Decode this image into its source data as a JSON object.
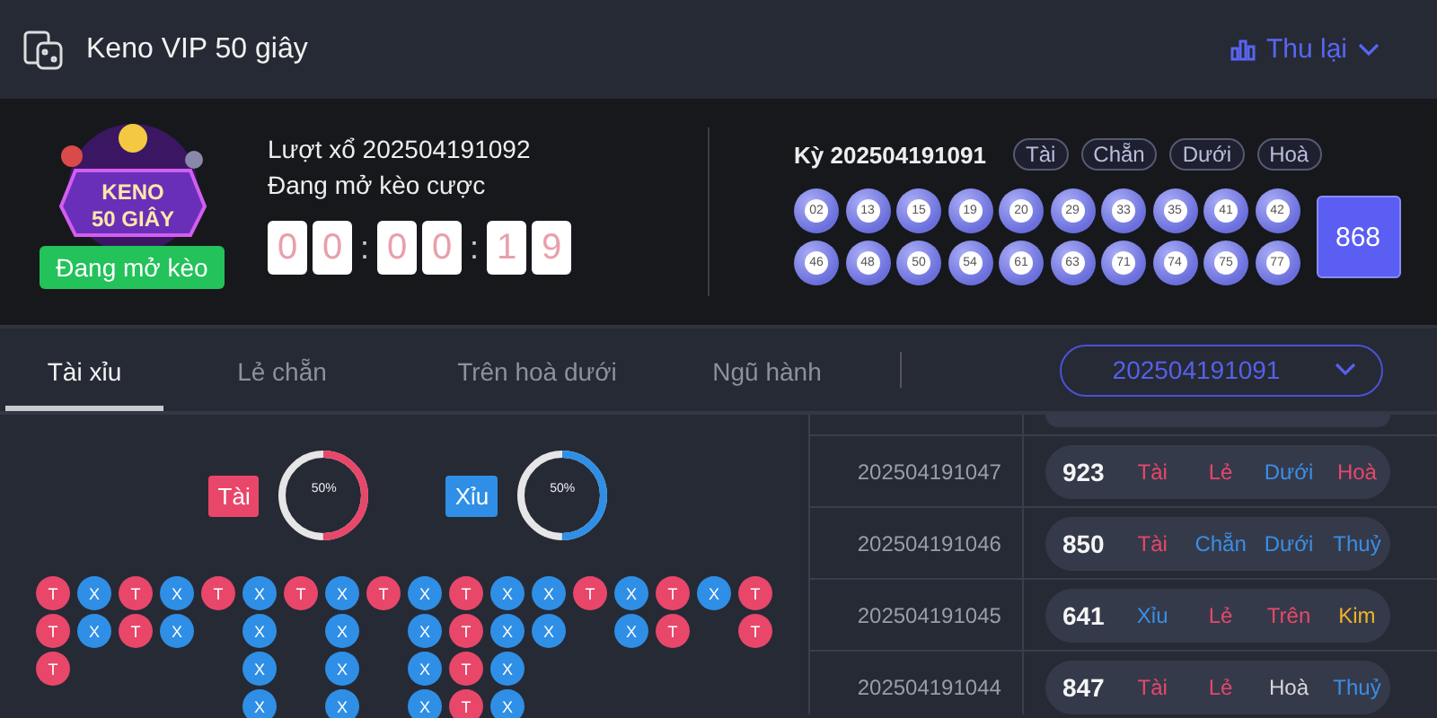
{
  "header": {
    "title": "Keno VIP 50 giây",
    "collapse_label": "Thu lại"
  },
  "current_draw": {
    "logo": {
      "line_1": "KENO",
      "line_2": "50 GIÂY"
    },
    "status_badge": "Đang mở kèo",
    "round_label": "Lượt xổ 202504191092",
    "status_text": "Đang mở kèo cược",
    "countdown": [
      {
        "kind": "digit",
        "text": "0"
      },
      {
        "kind": "digit",
        "text": "0"
      },
      {
        "kind": "separator",
        "text": ":"
      },
      {
        "kind": "digit",
        "text": "0"
      },
      {
        "kind": "digit",
        "text": "0"
      },
      {
        "kind": "separator",
        "text": ":"
      },
      {
        "kind": "digit",
        "text": "1"
      },
      {
        "kind": "digit",
        "text": "9"
      }
    ]
  },
  "last_draw": {
    "label": "Kỳ 202504191091",
    "tags": [
      "Tài",
      "Chẵn",
      "Dưới",
      "Hoà"
    ],
    "balls": [
      "02",
      "13",
      "15",
      "19",
      "20",
      "29",
      "33",
      "35",
      "41",
      "42",
      "46",
      "48",
      "50",
      "54",
      "61",
      "63",
      "71",
      "74",
      "75",
      "77"
    ],
    "total": "868"
  },
  "tabs": [
    {
      "label": "Tài xỉu",
      "selected": true
    },
    {
      "label": "Lẻ chẵn",
      "selected": false
    },
    {
      "label": "Trên hoà dưới",
      "selected": false
    },
    {
      "label": "Ngũ hành",
      "selected": false
    }
  ],
  "period_select": {
    "value": "202504191091"
  },
  "stats": [
    {
      "label": "Tài",
      "color": "#e8476a",
      "level": 0.5,
      "percent": "50%"
    },
    {
      "label": "Xỉu",
      "color": "#2f8fe6",
      "level": 0.5,
      "percent": "50%"
    }
  ],
  "bead_road": {
    "columns": [
      [
        {
          "label": "T",
          "color": "#e8476a"
        },
        {
          "label": "T",
          "color": "#e8476a"
        },
        {
          "label": "T",
          "color": "#e8476a"
        }
      ],
      [
        {
          "label": "X",
          "color": "#2f8fe6"
        },
        {
          "label": "X",
          "color": "#2f8fe6"
        }
      ],
      [
        {
          "label": "T",
          "color": "#e8476a"
        },
        {
          "label": "T",
          "color": "#e8476a"
        }
      ],
      [
        {
          "label": "X",
          "color": "#2f8fe6"
        },
        {
          "label": "X",
          "color": "#2f8fe6"
        }
      ],
      [
        {
          "label": "T",
          "color": "#e8476a"
        }
      ],
      [
        {
          "label": "X",
          "color": "#2f8fe6"
        },
        {
          "label": "X",
          "color": "#2f8fe6"
        },
        {
          "label": "X",
          "color": "#2f8fe6"
        },
        {
          "label": "X",
          "color": "#2f8fe6"
        }
      ],
      [
        {
          "label": "T",
          "color": "#e8476a"
        }
      ],
      [
        {
          "label": "X",
          "color": "#2f8fe6"
        },
        {
          "label": "X",
          "color": "#2f8fe6"
        },
        {
          "label": "X",
          "color": "#2f8fe6"
        },
        {
          "label": "X",
          "color": "#2f8fe6"
        }
      ],
      [
        {
          "label": "T",
          "color": "#e8476a"
        }
      ],
      [
        {
          "label": "X",
          "color": "#2f8fe6"
        },
        {
          "label": "X",
          "color": "#2f8fe6"
        },
        {
          "label": "X",
          "color": "#2f8fe6"
        },
        {
          "label": "X",
          "color": "#2f8fe6"
        }
      ],
      [
        {
          "label": "T",
          "color": "#e8476a"
        },
        {
          "label": "T",
          "color": "#e8476a"
        },
        {
          "label": "T",
          "color": "#e8476a"
        },
        {
          "label": "T",
          "color": "#e8476a"
        }
      ],
      [
        {
          "label": "X",
          "color": "#2f8fe6"
        },
        {
          "label": "X",
          "color": "#2f8fe6"
        },
        {
          "label": "X",
          "color": "#2f8fe6"
        },
        {
          "label": "X",
          "color": "#2f8fe6"
        }
      ],
      [
        {
          "label": "X",
          "color": "#2f8fe6"
        },
        {
          "label": "X",
          "color": "#2f8fe6"
        }
      ],
      [
        {
          "label": "T",
          "color": "#e8476a"
        }
      ],
      [
        {
          "label": "X",
          "color": "#2f8fe6"
        },
        {
          "label": "X",
          "color": "#2f8fe6"
        }
      ],
      [
        {
          "label": "T",
          "color": "#e8476a"
        },
        {
          "label": "T",
          "color": "#e8476a"
        }
      ],
      [
        {
          "label": "X",
          "color": "#2f8fe6"
        }
      ],
      [
        {
          "label": "T",
          "color": "#e8476a"
        },
        {
          "label": "T",
          "color": "#e8476a"
        }
      ]
    ]
  },
  "results": [
    {
      "period": "202504191047",
      "total": "923",
      "tags": [
        {
          "text": "Tài",
          "color": "#e8476a"
        },
        {
          "text": "Lẻ",
          "color": "#e8476a"
        },
        {
          "text": "Dưới",
          "color": "#3a8ee6"
        },
        {
          "text": "Hoà",
          "color": "#e8476a"
        }
      ]
    },
    {
      "period": "202504191046",
      "total": "850",
      "tags": [
        {
          "text": "Tài",
          "color": "#e8476a"
        },
        {
          "text": "Chẵn",
          "color": "#3a8ee6"
        },
        {
          "text": "Dưới",
          "color": "#3a8ee6"
        },
        {
          "text": "Thuỷ",
          "color": "#3a8ee6"
        }
      ]
    },
    {
      "period": "202504191045",
      "total": "641",
      "tags": [
        {
          "text": "Xỉu",
          "color": "#3a8ee6"
        },
        {
          "text": "Lẻ",
          "color": "#e8476a"
        },
        {
          "text": "Trên",
          "color": "#e8476a"
        },
        {
          "text": "Kim",
          "color": "#f0b429"
        }
      ]
    },
    {
      "period": "202504191044",
      "total": "847",
      "tags": [
        {
          "text": "Tài",
          "color": "#e8476a"
        },
        {
          "text": "Lẻ",
          "color": "#e8476a"
        },
        {
          "text": "Hoà",
          "color": "#d6d6d6"
        },
        {
          "text": "Thuỷ",
          "color": "#3a8ee6"
        }
      ]
    }
  ]
}
